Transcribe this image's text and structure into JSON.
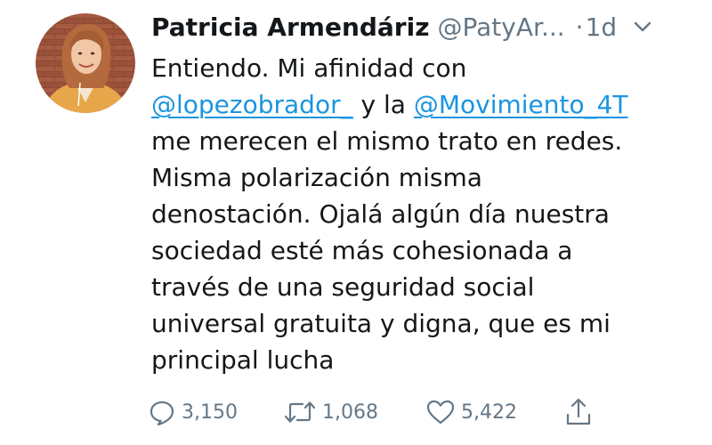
{
  "tweet": {
    "author": {
      "display_name": "Patricia Armendáriz",
      "handle": "@PatyAr...",
      "avatar_icon": "profile-photo"
    },
    "separator": "·",
    "timestamp": "1d",
    "menu_icon": "chevron-down-icon",
    "text_lines": [
      [
        {
          "t": "Entiendo. Mi afinidad con"
        }
      ],
      [
        {
          "t": "@lopezobrador_",
          "mention": true
        },
        {
          "t": " y la "
        },
        {
          "t": "@Movimiento_4T",
          "mention": true
        }
      ],
      [
        {
          "t": "me merecen el mismo trato en redes."
        }
      ],
      [
        {
          "t": "Misma polarización misma"
        }
      ],
      [
        {
          "t": "denostación. Ojalá algún día nuestra"
        }
      ],
      [
        {
          "t": "sociedad esté más cohesionada a"
        }
      ],
      [
        {
          "t": "través de una seguridad social"
        }
      ],
      [
        {
          "t": "universal gratuita y digna, que es mi"
        }
      ],
      [
        {
          "t": "principal lucha"
        }
      ]
    ],
    "actions": {
      "reply": {
        "icon": "reply-icon",
        "count": "3,150"
      },
      "retweet": {
        "icon": "retweet-icon",
        "count": "1,068"
      },
      "like": {
        "icon": "heart-icon",
        "count": "5,422"
      },
      "share": {
        "icon": "share-icon"
      }
    }
  },
  "colors": {
    "text": "#14171a",
    "muted": "#657786",
    "link": "#1b95e0",
    "background": "#ffffff"
  }
}
